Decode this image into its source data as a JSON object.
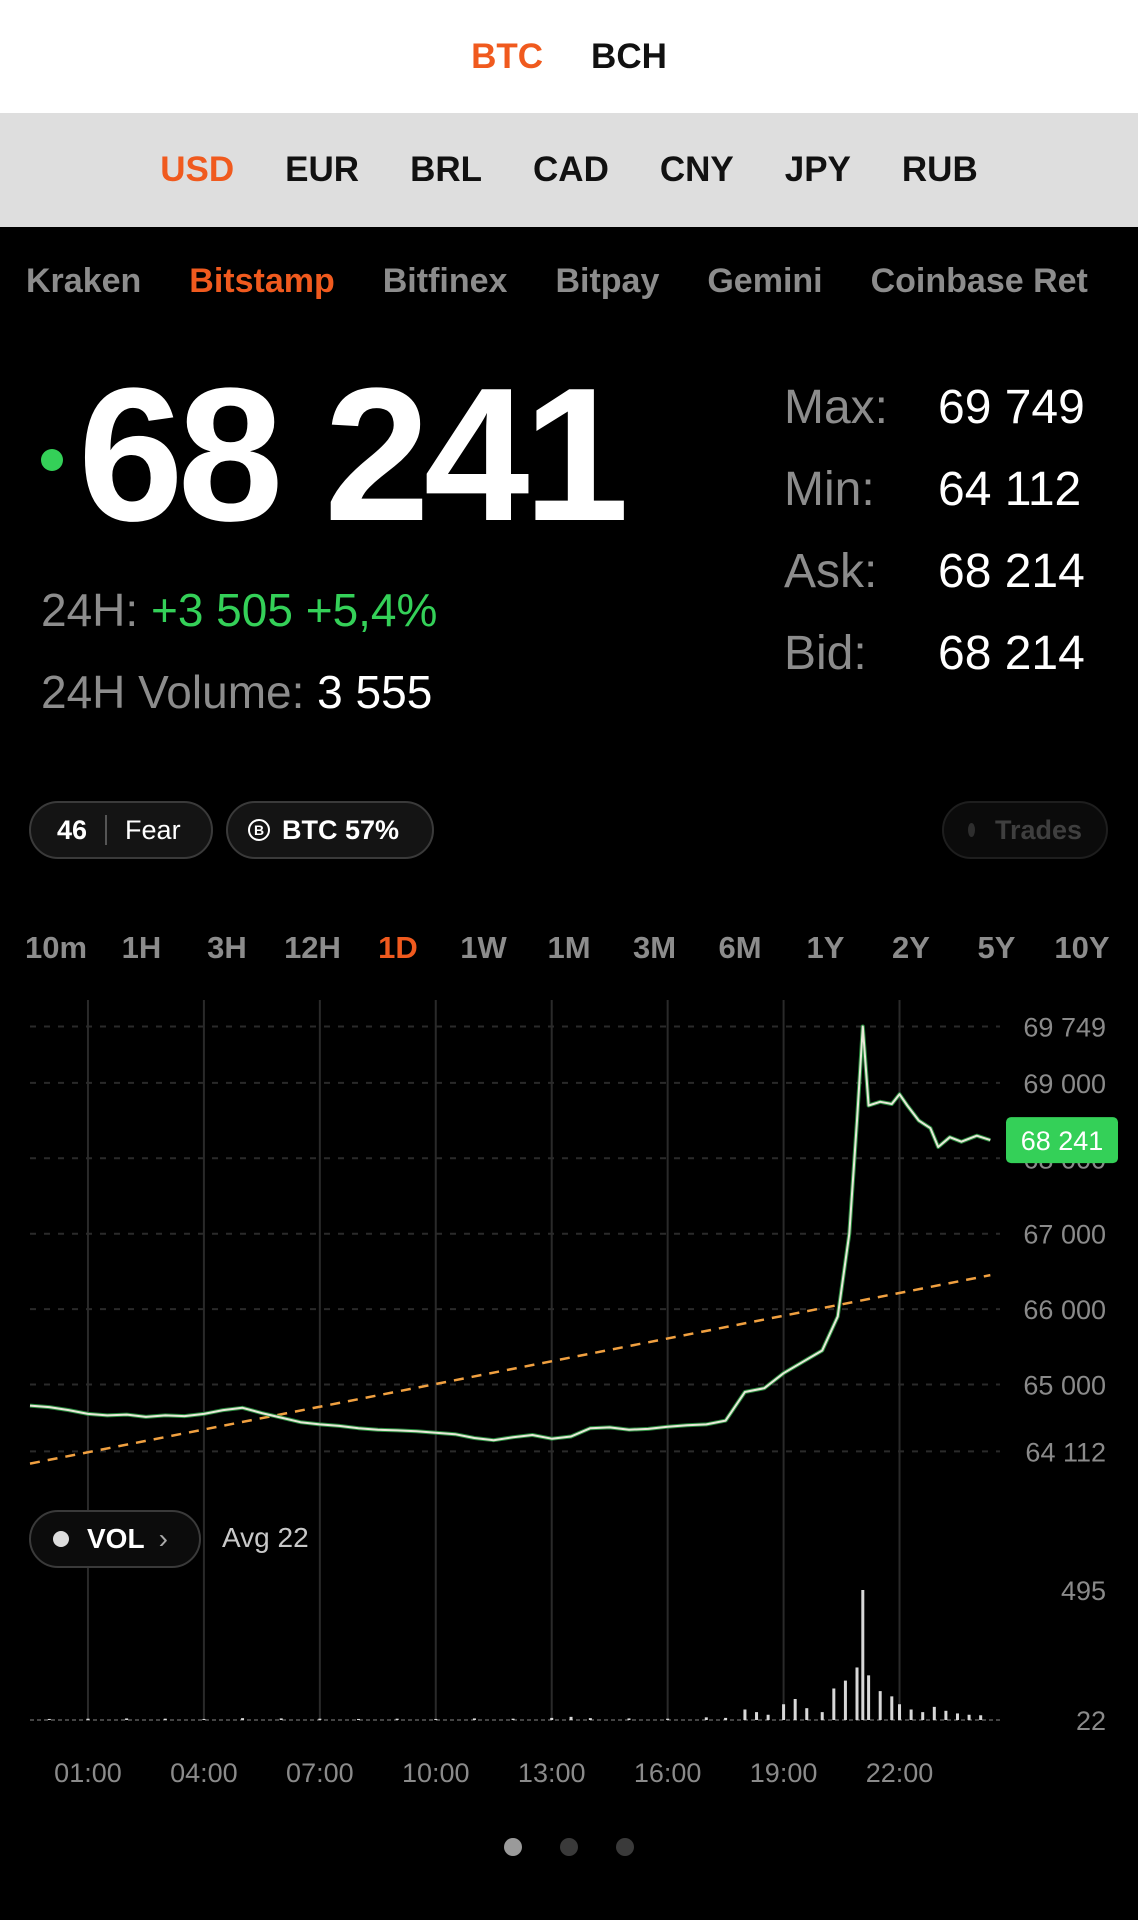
{
  "coins": [
    {
      "label": "BTC",
      "active": true
    },
    {
      "label": "BCH",
      "active": false
    }
  ],
  "currencies": [
    {
      "label": "USD",
      "active": true
    },
    {
      "label": "EUR",
      "active": false
    },
    {
      "label": "BRL",
      "active": false
    },
    {
      "label": "CAD",
      "active": false
    },
    {
      "label": "CNY",
      "active": false
    },
    {
      "label": "JPY",
      "active": false
    },
    {
      "label": "RUB",
      "active": false
    }
  ],
  "exchanges": [
    {
      "label": "Kraken",
      "active": false
    },
    {
      "label": "Bitstamp",
      "active": true
    },
    {
      "label": "Bitfinex",
      "active": false
    },
    {
      "label": "Bitpay",
      "active": false
    },
    {
      "label": "Gemini",
      "active": false
    },
    {
      "label": "Coinbase Ret",
      "active": false
    }
  ],
  "price": "68 241",
  "change": {
    "label": "24H:",
    "value": "+3 505 +5,4%"
  },
  "volume": {
    "label": "24H Volume:",
    "value": "3 555"
  },
  "stats": [
    {
      "label": "Max:",
      "value": "69 749"
    },
    {
      "label": "Min:",
      "value": "64 112"
    },
    {
      "label": "Ask:",
      "value": "68 214"
    },
    {
      "label": "Bid:",
      "value": "68 214"
    }
  ],
  "fear_greed": {
    "value": "46",
    "label": "Fear"
  },
  "dominance": {
    "icon": "bitcoin-circle-icon",
    "symbol": "B",
    "label": "BTC 57%"
  },
  "trades": {
    "label": "Trades"
  },
  "ranges": [
    {
      "label": "10m",
      "active": false
    },
    {
      "label": "1H",
      "active": false
    },
    {
      "label": "3H",
      "active": false
    },
    {
      "label": "12H",
      "active": false
    },
    {
      "label": "1D",
      "active": true
    },
    {
      "label": "1W",
      "active": false
    },
    {
      "label": "1M",
      "active": false
    },
    {
      "label": "3M",
      "active": false
    },
    {
      "label": "6M",
      "active": false
    },
    {
      "label": "1Y",
      "active": false
    },
    {
      "label": "2Y",
      "active": false
    },
    {
      "label": "5Y",
      "active": false
    },
    {
      "label": "10Y",
      "active": false
    }
  ],
  "colors": {
    "accent": "#f05a1e",
    "up": "#34d058",
    "trend": "#f0a040",
    "volume": "#d8d8d8",
    "grid": "#2a2a2a",
    "axis": "#8a8a8a"
  },
  "vol_control": {
    "label": "VOL",
    "chevron": "›",
    "avg": "Avg 22"
  },
  "chart_data": {
    "type": "line",
    "title": "",
    "x_ticks": [
      "01:00",
      "04:00",
      "07:00",
      "10:00",
      "13:00",
      "16:00",
      "19:00",
      "22:00"
    ],
    "y_ticks": [
      {
        "label": "69 749",
        "value": 69749
      },
      {
        "label": "69 000",
        "value": 69000
      },
      {
        "label": "68 000",
        "value": 68000
      },
      {
        "label": "67 000",
        "value": 67000
      },
      {
        "label": "66 000",
        "value": 66000
      },
      {
        "label": "65 000",
        "value": 65000
      },
      {
        "label": "64 112",
        "value": 64112
      }
    ],
    "ylim": [
      63600,
      70100
    ],
    "xlim": [
      -0.5,
      24.6
    ],
    "current": {
      "label": "68 241",
      "value": 68241
    },
    "series": [
      {
        "values": [
          [
            -0.5,
            64720
          ],
          [
            0,
            64700
          ],
          [
            0.5,
            64660
          ],
          [
            1,
            64610
          ],
          [
            1.5,
            64590
          ],
          [
            2,
            64600
          ],
          [
            2.5,
            64570
          ],
          [
            3,
            64590
          ],
          [
            3.5,
            64580
          ],
          [
            4,
            64610
          ],
          [
            4.5,
            64660
          ],
          [
            5,
            64690
          ],
          [
            5.5,
            64620
          ],
          [
            6,
            64560
          ],
          [
            6.5,
            64500
          ],
          [
            7,
            64470
          ],
          [
            7.5,
            64450
          ],
          [
            8,
            64420
          ],
          [
            8.5,
            64400
          ],
          [
            9,
            64390
          ],
          [
            9.5,
            64380
          ],
          [
            10,
            64360
          ],
          [
            10.5,
            64340
          ],
          [
            11,
            64290
          ],
          [
            11.5,
            64260
          ],
          [
            12,
            64300
          ],
          [
            12.5,
            64330
          ],
          [
            13,
            64280
          ],
          [
            13.5,
            64310
          ],
          [
            14,
            64420
          ],
          [
            14.5,
            64430
          ],
          [
            15,
            64400
          ],
          [
            15.5,
            64410
          ],
          [
            16,
            64440
          ],
          [
            16.5,
            64460
          ],
          [
            17,
            64470
          ],
          [
            17.5,
            64520
          ],
          [
            18,
            64900
          ],
          [
            18.5,
            64950
          ],
          [
            19,
            65150
          ],
          [
            19.5,
            65300
          ],
          [
            20,
            65450
          ],
          [
            20.4,
            65900
          ],
          [
            20.7,
            67000
          ],
          [
            20.9,
            68500
          ],
          [
            21.05,
            69749
          ],
          [
            21.2,
            68700
          ],
          [
            21.5,
            68750
          ],
          [
            21.8,
            68720
          ],
          [
            22,
            68850
          ],
          [
            22.2,
            68700
          ],
          [
            22.5,
            68500
          ],
          [
            22.8,
            68400
          ],
          [
            23,
            68150
          ],
          [
            23.3,
            68280
          ],
          [
            23.6,
            68220
          ],
          [
            24,
            68300
          ],
          [
            24.35,
            68241
          ]
        ]
      }
    ],
    "trend": {
      "values": [
        [
          -0.5,
          63950
        ],
        [
          24.35,
          66450
        ]
      ]
    },
    "volume": {
      "y_ticks": [
        {
          "label": "495",
          "value": 495
        },
        {
          "label": "22",
          "value": 22
        }
      ],
      "xlim": [
        -0.5,
        24.6
      ],
      "values": [
        [
          0,
          4
        ],
        [
          1,
          5
        ],
        [
          2,
          6
        ],
        [
          3,
          5
        ],
        [
          4,
          4
        ],
        [
          5,
          7
        ],
        [
          6,
          6
        ],
        [
          7,
          5
        ],
        [
          8,
          4
        ],
        [
          9,
          5
        ],
        [
          10,
          4
        ],
        [
          11,
          6
        ],
        [
          12,
          5
        ],
        [
          13,
          8
        ],
        [
          13.5,
          12
        ],
        [
          14,
          7
        ],
        [
          15,
          6
        ],
        [
          16,
          5
        ],
        [
          17,
          10
        ],
        [
          17.5,
          8
        ],
        [
          18,
          40
        ],
        [
          18.3,
          30
        ],
        [
          18.6,
          20
        ],
        [
          19,
          60
        ],
        [
          19.3,
          80
        ],
        [
          19.6,
          45
        ],
        [
          20,
          30
        ],
        [
          20.3,
          120
        ],
        [
          20.6,
          150
        ],
        [
          20.9,
          200
        ],
        [
          21.05,
          495
        ],
        [
          21.2,
          170
        ],
        [
          21.5,
          110
        ],
        [
          21.8,
          90
        ],
        [
          22,
          60
        ],
        [
          22.3,
          40
        ],
        [
          22.6,
          30
        ],
        [
          22.9,
          50
        ],
        [
          23.2,
          35
        ],
        [
          23.5,
          25
        ],
        [
          23.8,
          20
        ],
        [
          24.1,
          18
        ]
      ]
    }
  }
}
